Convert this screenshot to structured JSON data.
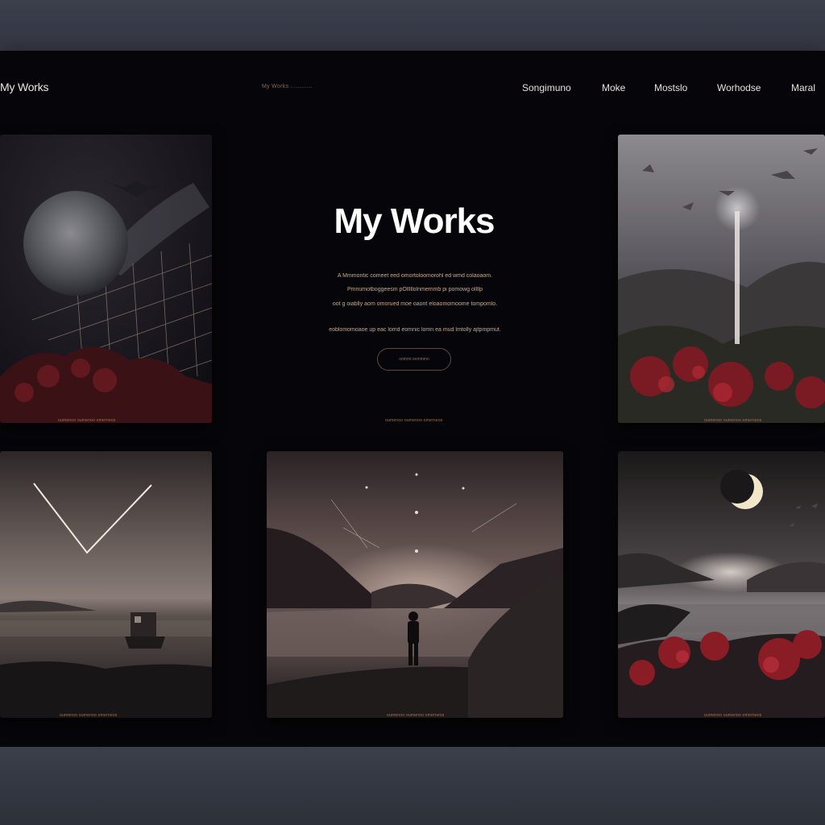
{
  "header": {
    "logo": "My Works",
    "center_text": "My Works ............",
    "nav": [
      "Songimuno",
      "Moke",
      "Mostslo",
      "Worhodse",
      "Maral"
    ]
  },
  "hero": {
    "title": "My Works",
    "description": [
      "A Mmmontic comeet eed omortoloomorohl ed wmd colaoaom.",
      "Pmnumotboggeesm pOlllllolnmemmb pi pomowg ollllp",
      "oot g oiablly aom omorued moe oaont eloaomomoome tompomlo.",
      "eoblomomoaoe up eac lomd eomnic lomn ea mud lmtolly ajtpmpmut."
    ],
    "button_label": "oommt oommmo"
  },
  "captions": {
    "moon_grid": "oumenoo oumenoo omerneos",
    "hero": "oumenoo oumenoo omerneos",
    "light_beam": "oumenoo oumenoo omerneos",
    "boat_sea": "oumenoo oumenoo omerneos",
    "lake_figure": "oumenoo oumenoo omerneos",
    "crescent_valley": "oumenoo oumenoo omerneos"
  },
  "colors": {
    "page_bg": "#060509",
    "accent": "#a77250",
    "title": "#ffffff"
  }
}
